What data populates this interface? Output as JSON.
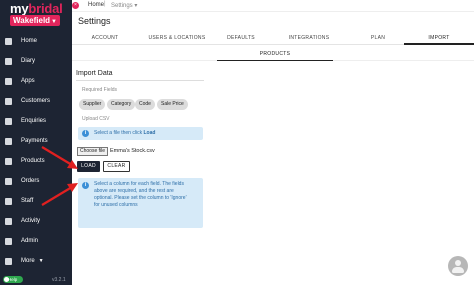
{
  "brand": {
    "name_prefix": "my",
    "name_rest": "bridal",
    "venue": "Wakefield"
  },
  "breadcrumb": {
    "home": "Home",
    "settings": "Settings"
  },
  "page_title": "Settings",
  "tabs": [
    "ACCOUNT",
    "USERS & LOCATIONS",
    "DEFAULTS",
    "INTEGRATIONS",
    "PLAN",
    "IMPORT"
  ],
  "active_tab": "IMPORT",
  "subtabs": [
    "PRODUCTS"
  ],
  "sidebar": {
    "items": [
      {
        "label": "Home",
        "icon": "home-icon"
      },
      {
        "label": "Diary",
        "icon": "calendar-icon"
      },
      {
        "label": "Apps",
        "icon": "apps-icon"
      },
      {
        "label": "Customers",
        "icon": "users-icon"
      },
      {
        "label": "Enquiries",
        "icon": "envelope-icon"
      },
      {
        "label": "Payments",
        "icon": "card-icon"
      },
      {
        "label": "Products",
        "icon": "tag-icon"
      },
      {
        "label": "Orders",
        "icon": "cart-icon"
      },
      {
        "label": "Staff",
        "icon": "staff-icon"
      },
      {
        "label": "Activity",
        "icon": "activity-icon"
      },
      {
        "label": "Admin",
        "icon": "admin-icon"
      },
      {
        "label": "More",
        "icon": "more-icon"
      }
    ],
    "help_label": "Help",
    "version": "v3.2.1"
  },
  "import": {
    "title": "Import Data",
    "required_label": "Required Fields",
    "required_fields": [
      "Supplier",
      "Category",
      "Code",
      "Sale Price"
    ],
    "upload_label": "Upload CSV",
    "info_select_file": {
      "pre": "Select a file then click ",
      "bold": "Load"
    },
    "choose_file": "Choose file",
    "file_name": "Emma's Stock.csv",
    "load": "LOAD",
    "clear": "CLEAR",
    "info_columns": [
      "Select a column for each field. The fields",
      "above are required, and the rest are",
      "optional. Please set the column to 'Ignore'",
      "for unused columns"
    ]
  },
  "colors": {
    "sidebar_bg": "#1d2433",
    "accent": "#e2255c",
    "info_bg": "#d6eaf8",
    "info_text": "#2e6fa8",
    "arrow": "#e02020"
  }
}
